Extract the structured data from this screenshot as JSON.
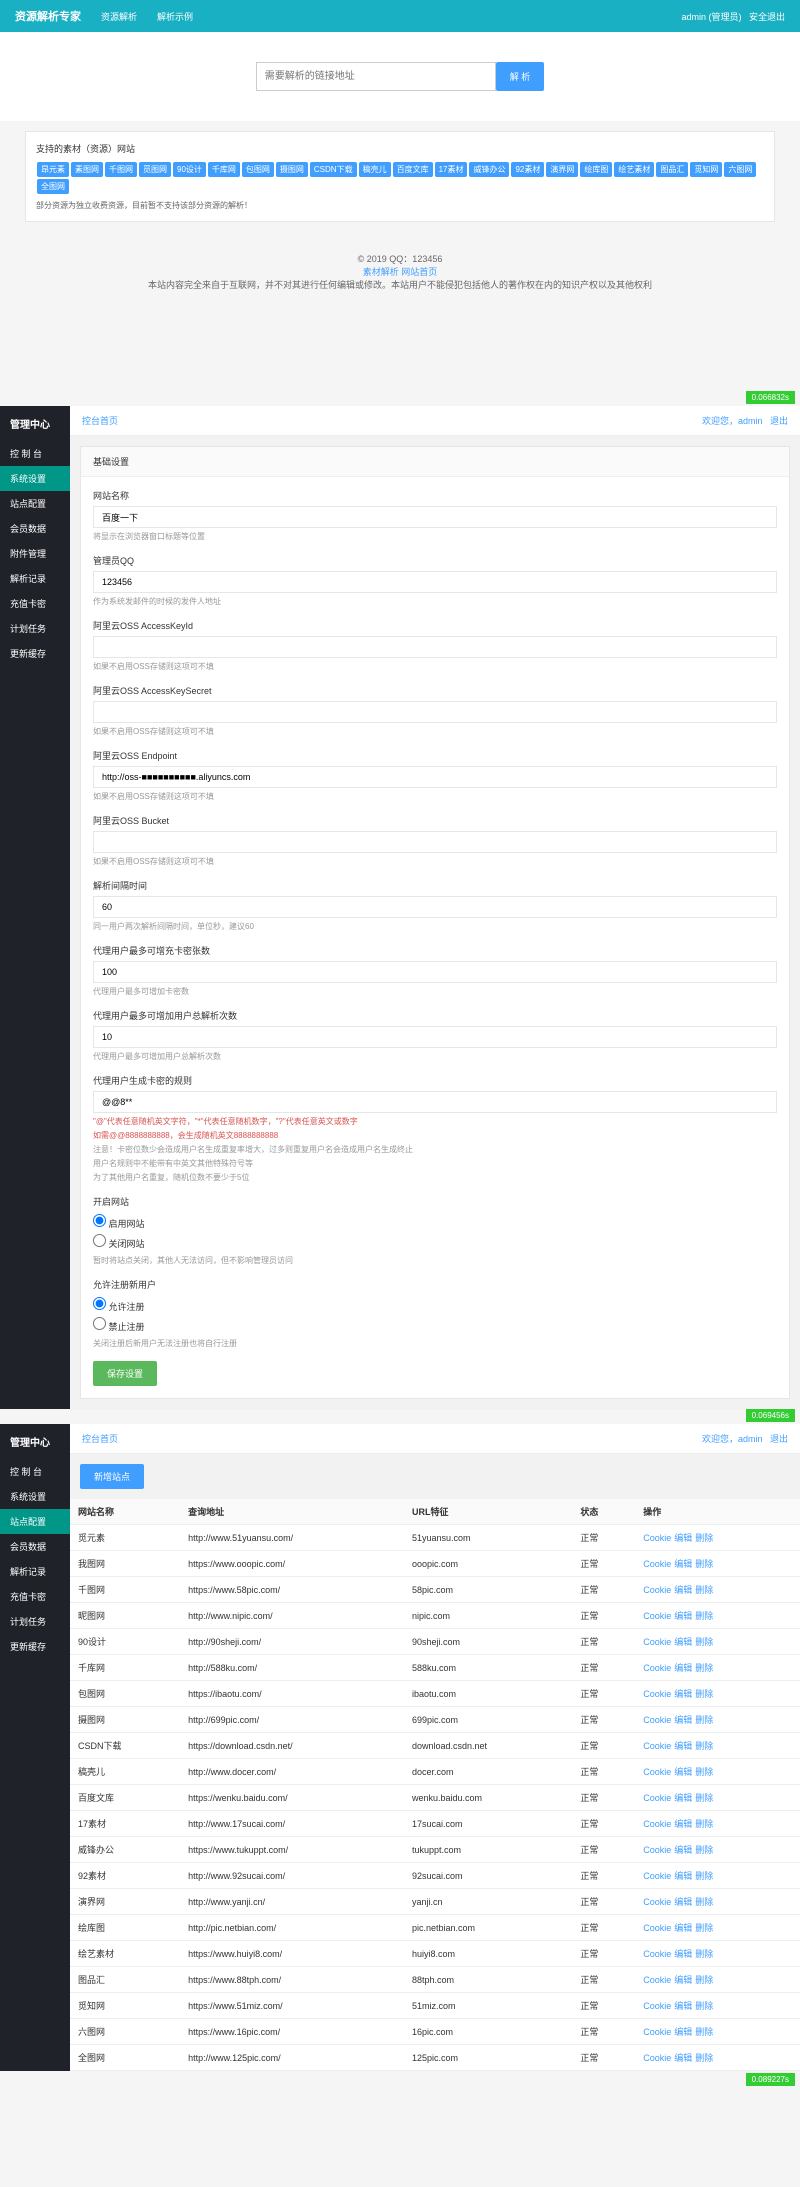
{
  "topbar": {
    "brand": "资源解析专家",
    "nav": [
      "资源解析",
      "解析示例"
    ],
    "user": "admin (管理员)",
    "logout": "安全退出"
  },
  "search": {
    "placeholder": "需要解析的链接地址",
    "button": "解 析"
  },
  "support": {
    "title": "支持的素材（资源）网站",
    "tags": [
      "昂元素",
      "素图网",
      "千图网",
      "觅图网",
      "90设计",
      "千库网",
      "包图网",
      "摄图网",
      "CSDN下载",
      "稿壳儿",
      "百度文库",
      "17素材",
      "威锋办公",
      "92素材",
      "演界网",
      "绘库图",
      "绘艺素材",
      "图品汇",
      "觅知网",
      "六图网",
      "全图网"
    ],
    "note": "部分资源为独立收费资源，目前暂不支持该部分资源的解析！"
  },
  "footer": {
    "copyright": "© 2019 QQ：123456",
    "links": "素材解析 网站首页",
    "disclaimer": "本站内容完全来自于互联网，并不对其进行任何编辑或修改。本站用户不能侵犯包括他人的著作权在内的知识产权以及其他权利"
  },
  "timers": [
    "0.066832s",
    "0.069456s",
    "0.089227s"
  ],
  "sidebar": {
    "title": "管理中心",
    "items": [
      "控 制 台",
      "系统设置",
      "站点配置",
      "会员数据",
      "附件管理",
      "解析记录",
      "充值卡密",
      "计划任务",
      "更新缓存"
    ]
  },
  "sidebar2": {
    "items": [
      "控 制 台",
      "系统设置",
      "站点配置",
      "会员数据",
      "解析记录",
      "充值卡密",
      "计划任务",
      "更新缓存"
    ]
  },
  "crumb": {
    "home": "控台首页",
    "welcome": "欢迎您，admin",
    "logout": "退出"
  },
  "settings": {
    "header": "基础设置",
    "fields": [
      {
        "label": "网站名称",
        "value": "百度一下",
        "hint": "将显示在浏览器窗口标题等位置"
      },
      {
        "label": "管理员QQ",
        "value": "123456",
        "hint": "作为系统发邮件的时候的发件人地址"
      },
      {
        "label": "阿里云OSS AccessKeyId",
        "value": "",
        "hint": "如果不启用OSS存储则这项可不填"
      },
      {
        "label": "阿里云OSS AccessKeySecret",
        "value": "",
        "hint": "如果不启用OSS存储则这项可不填"
      },
      {
        "label": "阿里云OSS Endpoint",
        "value": "http://oss-■■■■■■■■■■.aliyuncs.com",
        "hint": "如果不启用OSS存储则这项可不填"
      },
      {
        "label": "阿里云OSS Bucket",
        "value": "",
        "hint": "如果不启用OSS存储则这项可不填"
      },
      {
        "label": "解析间隔时间",
        "value": "60",
        "hint": "同一用户两次解析间隔时间，单位秒，建议60"
      },
      {
        "label": "代理用户最多可增充卡密张数",
        "value": "100",
        "hint": "代理用户最多可增加卡密数"
      },
      {
        "label": "代理用户最多可增加用户总解析次数",
        "value": "10",
        "hint": "代理用户最多可增加用户总解析次数"
      },
      {
        "label": "代理用户生成卡密的规则",
        "value": "@@8**",
        "hint": "\"@\"代表任意随机英文字符，\"*\"代表任意随机数字，\"?\"代表任意英文或数字",
        "hint2": "如需@@8888888888，会生成随机英文8888888888",
        "hint3": "注意！卡密位数少会造成用户名生成重复率增大，过多则重复用户名会造成用户名生成终止",
        "hint4": "用户名规则中不能带有中英文其他特殊符号等",
        "hint5": "为了其他用户名重复，随机位数不要少于5位"
      }
    ],
    "siteStatus": {
      "label": "开启网站",
      "on": "启用网站",
      "off": "关闭网站",
      "hint": "暂时将站点关闭，其他人无法访问，但不影响管理员访问"
    },
    "register": {
      "label": "允许注册新用户",
      "on": "允许注册",
      "off": "禁止注册",
      "hint": "关闭注册后新用户无法注册也将自行注册"
    },
    "save": "保存设置"
  },
  "sites": {
    "addBtn": "新增站点",
    "columns": [
      "网站名称",
      "查询地址",
      "URL特征",
      "状态",
      "操作"
    ],
    "actions": [
      "Cookie",
      "编辑",
      "删除"
    ],
    "status": "正常",
    "rows": [
      [
        "觅元素",
        "http://www.51yuansu.com/",
        "51yuansu.com"
      ],
      [
        "我图网",
        "https://www.ooopic.com/",
        "ooopic.com"
      ],
      [
        "千图网",
        "https://www.58pic.com/",
        "58pic.com"
      ],
      [
        "昵图网",
        "http://www.nipic.com/",
        "nipic.com"
      ],
      [
        "90设计",
        "http://90sheji.com/",
        "90sheji.com"
      ],
      [
        "千库网",
        "http://588ku.com/",
        "588ku.com"
      ],
      [
        "包图网",
        "https://ibaotu.com/",
        "ibaotu.com"
      ],
      [
        "摄图网",
        "http://699pic.com/",
        "699pic.com"
      ],
      [
        "CSDN下载",
        "https://download.csdn.net/",
        "download.csdn.net"
      ],
      [
        "稿壳儿",
        "http://www.docer.com/",
        "docer.com"
      ],
      [
        "百度文库",
        "https://wenku.baidu.com/",
        "wenku.baidu.com"
      ],
      [
        "17素材",
        "http://www.17sucai.com/",
        "17sucai.com"
      ],
      [
        "威锋办公",
        "https://www.tukuppt.com/",
        "tukuppt.com"
      ],
      [
        "92素材",
        "http://www.92sucai.com/",
        "92sucai.com"
      ],
      [
        "演界网",
        "http://www.yanji.cn/",
        "yanji.cn"
      ],
      [
        "绘库图",
        "http://pic.netbian.com/",
        "pic.netbian.com"
      ],
      [
        "绘艺素材",
        "https://www.huiyi8.com/",
        "huiyi8.com"
      ],
      [
        "图品汇",
        "https://www.88tph.com/",
        "88tph.com"
      ],
      [
        "觅知网",
        "https://www.51miz.com/",
        "51miz.com"
      ],
      [
        "六图网",
        "https://www.16pic.com/",
        "16pic.com"
      ],
      [
        "全图网",
        "http://www.125pic.com/",
        "125pic.com"
      ]
    ]
  }
}
